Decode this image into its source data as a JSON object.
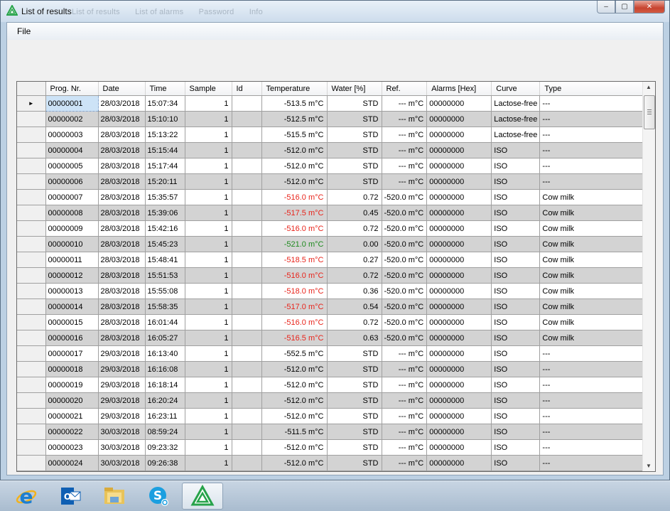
{
  "window": {
    "title": "List of results",
    "ghost_tabs": [
      "List of results",
      "List of alarms",
      "Password",
      "Info"
    ],
    "minimize": "–",
    "maximize": "▢",
    "close": "✕"
  },
  "menu": {
    "file": "File"
  },
  "table": {
    "columns": [
      "Prog. Nr.",
      "Date",
      "Time",
      "Sample",
      "Id",
      "Temperature",
      "Water [%]",
      "Ref.",
      "Alarms [Hex]",
      "Curve",
      "Type"
    ],
    "rows": [
      [
        "00000001",
        "28/03/2018",
        "15:07:34",
        "1",
        "",
        "-513.5 m°C",
        "STD",
        "--- m°C",
        "00000000",
        "Lactose-free",
        "---"
      ],
      [
        "00000002",
        "28/03/2018",
        "15:10:10",
        "1",
        "",
        "-512.5 m°C",
        "STD",
        "--- m°C",
        "00000000",
        "Lactose-free",
        "---"
      ],
      [
        "00000003",
        "28/03/2018",
        "15:13:22",
        "1",
        "",
        "-515.5 m°C",
        "STD",
        "--- m°C",
        "00000000",
        "Lactose-free",
        "---"
      ],
      [
        "00000004",
        "28/03/2018",
        "15:15:44",
        "1",
        "",
        "-512.0 m°C",
        "STD",
        "--- m°C",
        "00000000",
        "ISO",
        "---"
      ],
      [
        "00000005",
        "28/03/2018",
        "15:17:44",
        "1",
        "",
        "-512.0 m°C",
        "STD",
        "--- m°C",
        "00000000",
        "ISO",
        "---"
      ],
      [
        "00000006",
        "28/03/2018",
        "15:20:11",
        "1",
        "",
        "-512.0 m°C",
        "STD",
        "--- m°C",
        "00000000",
        "ISO",
        "---"
      ],
      [
        "00000007",
        "28/03/2018",
        "15:35:57",
        "1",
        "",
        "-516.0 m°C",
        "0.72",
        "-520.0 m°C",
        "00000000",
        "ISO",
        "Cow milk"
      ],
      [
        "00000008",
        "28/03/2018",
        "15:39:06",
        "1",
        "",
        "-517.5 m°C",
        "0.45",
        "-520.0 m°C",
        "00000000",
        "ISO",
        "Cow milk"
      ],
      [
        "00000009",
        "28/03/2018",
        "15:42:16",
        "1",
        "",
        "-516.0 m°C",
        "0.72",
        "-520.0 m°C",
        "00000000",
        "ISO",
        "Cow milk"
      ],
      [
        "00000010",
        "28/03/2018",
        "15:45:23",
        "1",
        "",
        "-521.0 m°C",
        "0.00",
        "-520.0 m°C",
        "00000000",
        "ISO",
        "Cow milk"
      ],
      [
        "00000011",
        "28/03/2018",
        "15:48:41",
        "1",
        "",
        "-518.5 m°C",
        "0.27",
        "-520.0 m°C",
        "00000000",
        "ISO",
        "Cow milk"
      ],
      [
        "00000012",
        "28/03/2018",
        "15:51:53",
        "1",
        "",
        "-516.0 m°C",
        "0.72",
        "-520.0 m°C",
        "00000000",
        "ISO",
        "Cow milk"
      ],
      [
        "00000013",
        "28/03/2018",
        "15:55:08",
        "1",
        "",
        "-518.0 m°C",
        "0.36",
        "-520.0 m°C",
        "00000000",
        "ISO",
        "Cow milk"
      ],
      [
        "00000014",
        "28/03/2018",
        "15:58:35",
        "1",
        "",
        "-517.0 m°C",
        "0.54",
        "-520.0 m°C",
        "00000000",
        "ISO",
        "Cow milk"
      ],
      [
        "00000015",
        "28/03/2018",
        "16:01:44",
        "1",
        "",
        "-516.0 m°C",
        "0.72",
        "-520.0 m°C",
        "00000000",
        "ISO",
        "Cow milk"
      ],
      [
        "00000016",
        "28/03/2018",
        "16:05:27",
        "1",
        "",
        "-516.5 m°C",
        "0.63",
        "-520.0 m°C",
        "00000000",
        "ISO",
        "Cow milk"
      ],
      [
        "00000017",
        "29/03/2018",
        "16:13:40",
        "1",
        "",
        "-552.5 m°C",
        "STD",
        "--- m°C",
        "00000000",
        "ISO",
        "---"
      ],
      [
        "00000018",
        "29/03/2018",
        "16:16:08",
        "1",
        "",
        "-512.0 m°C",
        "STD",
        "--- m°C",
        "00000000",
        "ISO",
        "---"
      ],
      [
        "00000019",
        "29/03/2018",
        "16:18:14",
        "1",
        "",
        "-512.0 m°C",
        "STD",
        "--- m°C",
        "00000000",
        "ISO",
        "---"
      ],
      [
        "00000020",
        "29/03/2018",
        "16:20:24",
        "1",
        "",
        "-512.0 m°C",
        "STD",
        "--- m°C",
        "00000000",
        "ISO",
        "---"
      ],
      [
        "00000021",
        "29/03/2018",
        "16:23:11",
        "1",
        "",
        "-512.0 m°C",
        "STD",
        "--- m°C",
        "00000000",
        "ISO",
        "---"
      ],
      [
        "00000022",
        "30/03/2018",
        "08:59:24",
        "1",
        "",
        "-511.5 m°C",
        "STD",
        "--- m°C",
        "00000000",
        "ISO",
        "---"
      ],
      [
        "00000023",
        "30/03/2018",
        "09:23:32",
        "1",
        "",
        "-512.0 m°C",
        "STD",
        "--- m°C",
        "00000000",
        "ISO",
        "---"
      ],
      [
        "00000024",
        "30/03/2018",
        "09:26:38",
        "1",
        "",
        "-512.0 m°C",
        "STD",
        "--- m°C",
        "00000000",
        "ISO",
        "---"
      ]
    ],
    "temperature_colors": {
      "red": [
        "00000007",
        "00000008",
        "00000009",
        "00000011",
        "00000012",
        "00000013",
        "00000014",
        "00000015",
        "00000016"
      ],
      "green": [
        "00000010"
      ]
    },
    "selected_row": "00000001",
    "row_indicator": "►"
  },
  "colors": {
    "red_text": "#e8231a",
    "green_text": "#1e8a1e",
    "selection": "#cde3f7"
  },
  "taskbar": {
    "items": [
      {
        "name": "internet-explorer-icon",
        "active": false
      },
      {
        "name": "outlook-icon",
        "active": false
      },
      {
        "name": "file-explorer-icon",
        "active": false
      },
      {
        "name": "skype-icon",
        "active": false
      },
      {
        "name": "results-app-icon",
        "active": true
      }
    ]
  }
}
